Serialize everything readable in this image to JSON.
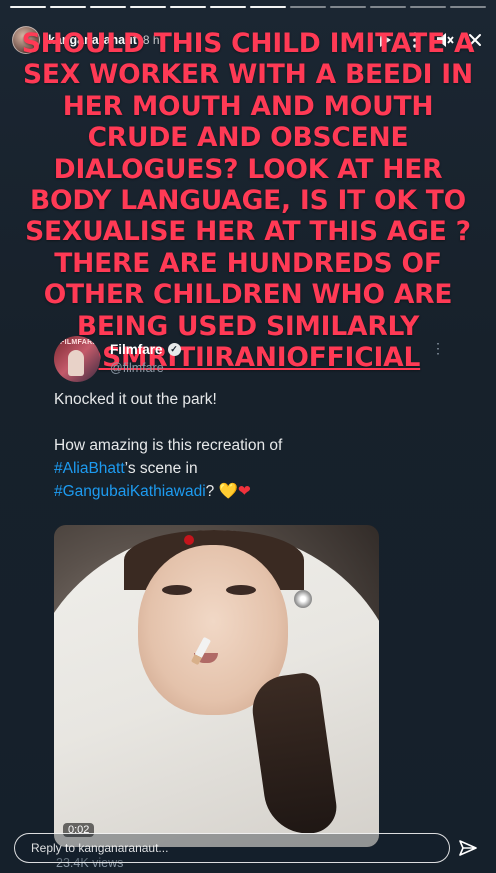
{
  "story": {
    "progress_segments": 12,
    "active_segment": 6,
    "header": {
      "username": "kanganaranaut",
      "time": "8 h",
      "icons": [
        "play-icon",
        "more-icon",
        "mute-icon",
        "close-icon"
      ]
    },
    "headline": {
      "text_before": "SHOULD THIS CHILD IMITATE A SEX WORKER WITH A BEEDI IN HER MOUTH AND MOUTH CRUDE AND OBSCENE DIALOGUES?  LOOK AT HER BODY LANGUAGE, IS IT OK TO SEXUALISE HER AT THIS AGE ? THERE ARE HUNDREDS OF OTHER CHILDREN WHO ARE BEING USED SIMILARLY ",
      "mention": "@SMRITIIRANIOFFICIAL",
      "color": "#ff3a55"
    },
    "tweet": {
      "display_name": "Filmfare",
      "handle": "@filmfare",
      "avatar_label": "FILMFARE",
      "line1": "Knocked it out the park!",
      "line2": "How amazing is this recreation of",
      "hashtag1": "#AliaBhatt",
      "line3_suffix": "’s scene in",
      "hashtag2": "#GangubaiKathiawadi",
      "line4_suffix": "?",
      "heart_yellow": "💛",
      "heart_red": "❤",
      "video_duration": "0:02",
      "views": "23.4K views",
      "link_color": "#1d9bf0"
    },
    "reply": {
      "placeholder": "Reply to kanganaranaut..."
    }
  }
}
